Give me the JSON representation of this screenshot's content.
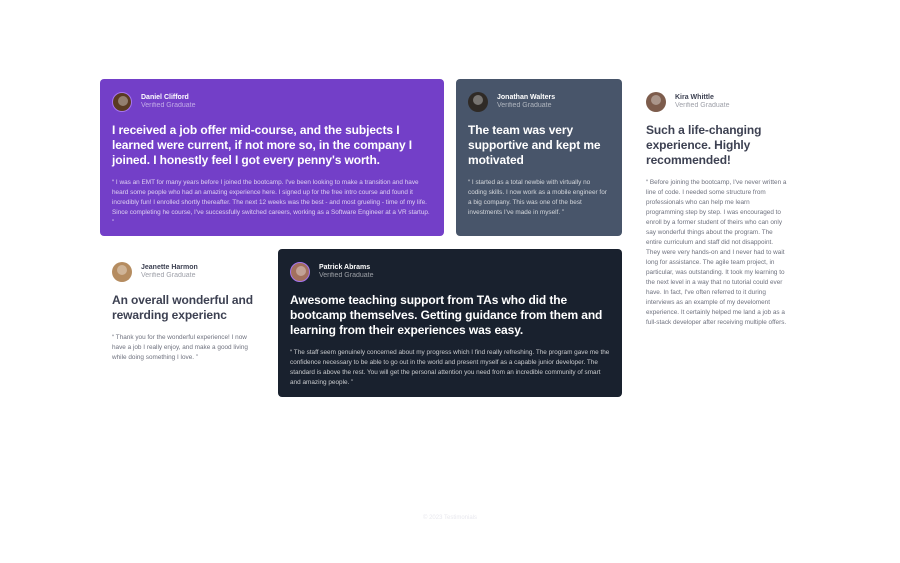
{
  "testimonials": [
    {
      "name": "Daniel Clifford",
      "status": "Verified Graduate",
      "headline": "I received a job offer mid-course, and the subjects I learned were current, if not more so, in the company I joined. I honestly feel I got every penny's worth.",
      "quote": "“ I was an EMT for many years before I joined the bootcamp. I've been looking to make a transition and have heard some people who had an amazing experience here. I signed up for the free intro course and found it incredibly fun! I enrolled shortly thereafter. The next 12 weeks was the best - and most grueling - time of my life. Since completing he course, I've successfully switched careers, working as a Software Engineer at a VR startup. ”"
    },
    {
      "name": "Jonathan Walters",
      "status": "Verified Graduate",
      "headline": "The team was very supportive and kept me motivated",
      "quote": "“ I started as a total newbie with virtually no coding skills. I now work as a mobile engineer for a big company. This was one of the best investments I've made in myself. ”"
    },
    {
      "name": "Kira Whittle",
      "status": "Verified Graduate",
      "headline": "Such a life-changing experience. Highly recommended!",
      "quote": "“ Before joining the bootcamp, I've never written a line of code. I needed some structure from professionals who can help me learn programming step by step. I was encouraged to enroll by a former student of theirs who can only say wonderful things about the program. The entire curriculum and staff did not disappoint. They were very hands-on and I never had to wait long for assistance. The agile team project, in particular, was outstanding. It took my learning to the next level in a way that no tutorial could ever have. In fact, I've often referred to it during interviews as an example of my develoment experience. It certainly helped me land a job as a full-stack developer after receiving multiple offers."
    },
    {
      "name": "Jeanette Harmon",
      "status": "Verified Graduate",
      "headline": "An overall wonderful and rewarding experienc",
      "quote": "“ Thank you for the wonderful experience! I now have a job I really enjoy, and make a good living while doing something I love. ”"
    },
    {
      "name": "Patrick Abrams",
      "status": "Verified Graduate",
      "headline": "Awesome teaching support from TAs who did the bootcamp themselves. Getting guidance from them and learning from their experiences was easy.",
      "quote": "“ The staff seem genuinely concerned about my progress which I find really refreshing. The program gave me the confidence necessary to be able to go out in the world and present myself as a capable junior developer. The standard is above the rest. You will get the personal attention you need from an incredible community of smart and amazing people. ”"
    }
  ],
  "footer": {
    "attribution": "© 2023 Testimonials"
  }
}
